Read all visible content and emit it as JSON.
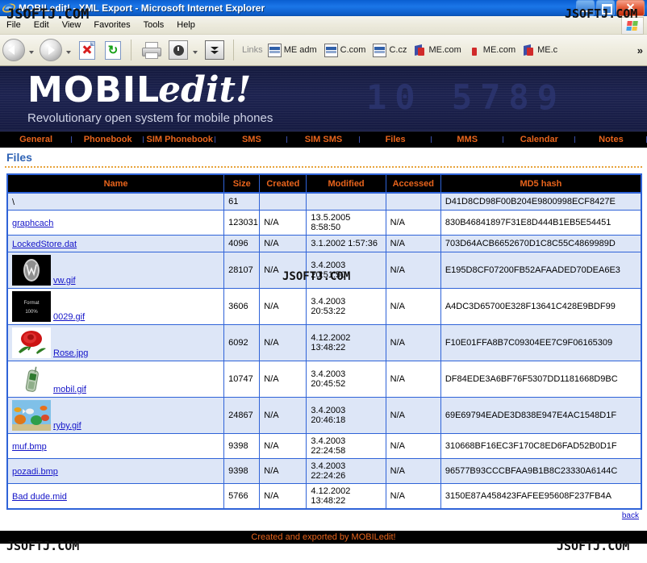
{
  "window": {
    "title": "MOBILedit! - XML Export - Microsoft Internet Explorer",
    "minimize_label": "Minimize",
    "maximize_label": "Maximize",
    "close_label": "Close"
  },
  "menu": {
    "items": [
      "File",
      "Edit",
      "View",
      "Favorites",
      "Tools",
      "Help"
    ]
  },
  "toolbar": {
    "back_label": "Back",
    "forward_label": "Forward",
    "stop_label": "Stop",
    "refresh_label": "Refresh",
    "print_label": "Print",
    "history_label": "History",
    "more_label": "More",
    "refresh_glyph": "↻",
    "overflow_glyph": "»",
    "links_label": "Links",
    "links": [
      {
        "label": "ME adm",
        "icon": "page-icon"
      },
      {
        "label": "C.com",
        "icon": "page-icon"
      },
      {
        "label": "C.cz",
        "icon": "page-icon"
      },
      {
        "label": "ME.com",
        "icon": "me-icon"
      },
      {
        "label": "ME.com",
        "icon": "me-thin-icon"
      },
      {
        "label": "ME.c",
        "icon": "me-icon"
      }
    ]
  },
  "banner": {
    "logo_first": "MOBIL",
    "logo_second": "edit!",
    "tagline": "Revolutionary open system for mobile phones",
    "digits": "10 5789"
  },
  "nav": {
    "tabs": [
      "General",
      "Phonebook",
      "SIM Phonebook",
      "SMS",
      "SIM SMS",
      "Files",
      "MMS",
      "Calendar",
      "Notes"
    ]
  },
  "section": {
    "title": "Files"
  },
  "table": {
    "columns": [
      "Name",
      "Size",
      "Created",
      "Modified",
      "Accessed",
      "MD5 hash"
    ],
    "rows": [
      {
        "name": "\\",
        "is_link": false,
        "thumb": null,
        "size": "61",
        "created": "",
        "modified": "",
        "accessed": "",
        "md5": "D41D8CD98F00B204E9800998ECF8427E"
      },
      {
        "name": "graphcach",
        "is_link": true,
        "thumb": null,
        "size": "123031",
        "created": "N/A",
        "modified": "13.5.2005 8:58:50",
        "accessed": "N/A",
        "md5": "830B46841897F31E8D444B1EB5E54451"
      },
      {
        "name": "LockedStore.dat",
        "is_link": true,
        "thumb": null,
        "size": "4096",
        "created": "N/A",
        "modified": "3.1.2002 1:57:36",
        "accessed": "N/A",
        "md5": "703D64ACB6652670D1C8C55C4869989D"
      },
      {
        "name": "vw.gif",
        "is_link": true,
        "thumb": "vw-logo-thumbnail",
        "size": "28107",
        "created": "N/A",
        "modified": "3.4.2003 20:51:50",
        "accessed": "N/A",
        "md5": "E195D8CF07200FB52AFAADED70DEA6E3"
      },
      {
        "name": "0029.gif",
        "is_link": true,
        "thumb": "black-text-thumbnail",
        "size": "3606",
        "created": "N/A",
        "modified": "3.4.2003 20:53:22",
        "accessed": "N/A",
        "md5": "A4DC3D65700E328F13641C428E9BDF99"
      },
      {
        "name": "Rose.jpg",
        "is_link": true,
        "thumb": "red-rose-thumbnail",
        "size": "6092",
        "created": "N/A",
        "modified": "4.12.2002 13:48:22",
        "accessed": "N/A",
        "md5": "F10E01FFA8B7C09304EE7C9F06165309"
      },
      {
        "name": "mobil.gif",
        "is_link": true,
        "thumb": "mobile-phone-thumbnail",
        "size": "10747",
        "created": "N/A",
        "modified": "3.4.2003 20:45:52",
        "accessed": "N/A",
        "md5": "DF84EDE3A6BF76F5307DD1181668D9BC"
      },
      {
        "name": "ryby.gif",
        "is_link": true,
        "thumb": "aquarium-fish-thumbnail",
        "size": "24867",
        "created": "N/A",
        "modified": "3.4.2003 20:46:18",
        "accessed": "N/A",
        "md5": "69E69794EADE3D838E947E4AC1548D1F"
      },
      {
        "name": "muf.bmp",
        "is_link": true,
        "thumb": null,
        "size": "9398",
        "created": "N/A",
        "modified": "3.4.2003 22:24:58",
        "accessed": "N/A",
        "md5": "310668BF16EC3F170C8ED6FAD52B0D1F"
      },
      {
        "name": "pozadi.bmp",
        "is_link": true,
        "thumb": null,
        "size": "9398",
        "created": "N/A",
        "modified": "3.4.2003 22:24:26",
        "accessed": "N/A",
        "md5": "96577B93CCCBFAA9B1B8C23330A6144C"
      },
      {
        "name": "Bad dude.mid",
        "is_link": true,
        "thumb": null,
        "size": "5766",
        "created": "N/A",
        "modified": "4.12.2002 13:48:22",
        "accessed": "N/A",
        "md5": "3150E87A458423FAFEE95608F237FB4A"
      }
    ]
  },
  "footer": {
    "back_label": "back",
    "credit": "Created and exported by MOBILedit!"
  },
  "watermark": {
    "text": "JSOFTJ.COM"
  },
  "thumb_text": {
    "line1": "Format",
    "line2": "100%"
  },
  "colors": {
    "accent_orange": "#e8641c",
    "link_blue": "#1414c8",
    "table_border": "#2f63d8",
    "row_alt": "#dde6f7",
    "banner_navy": "#1d2350",
    "section_title": "#2f63b5"
  }
}
